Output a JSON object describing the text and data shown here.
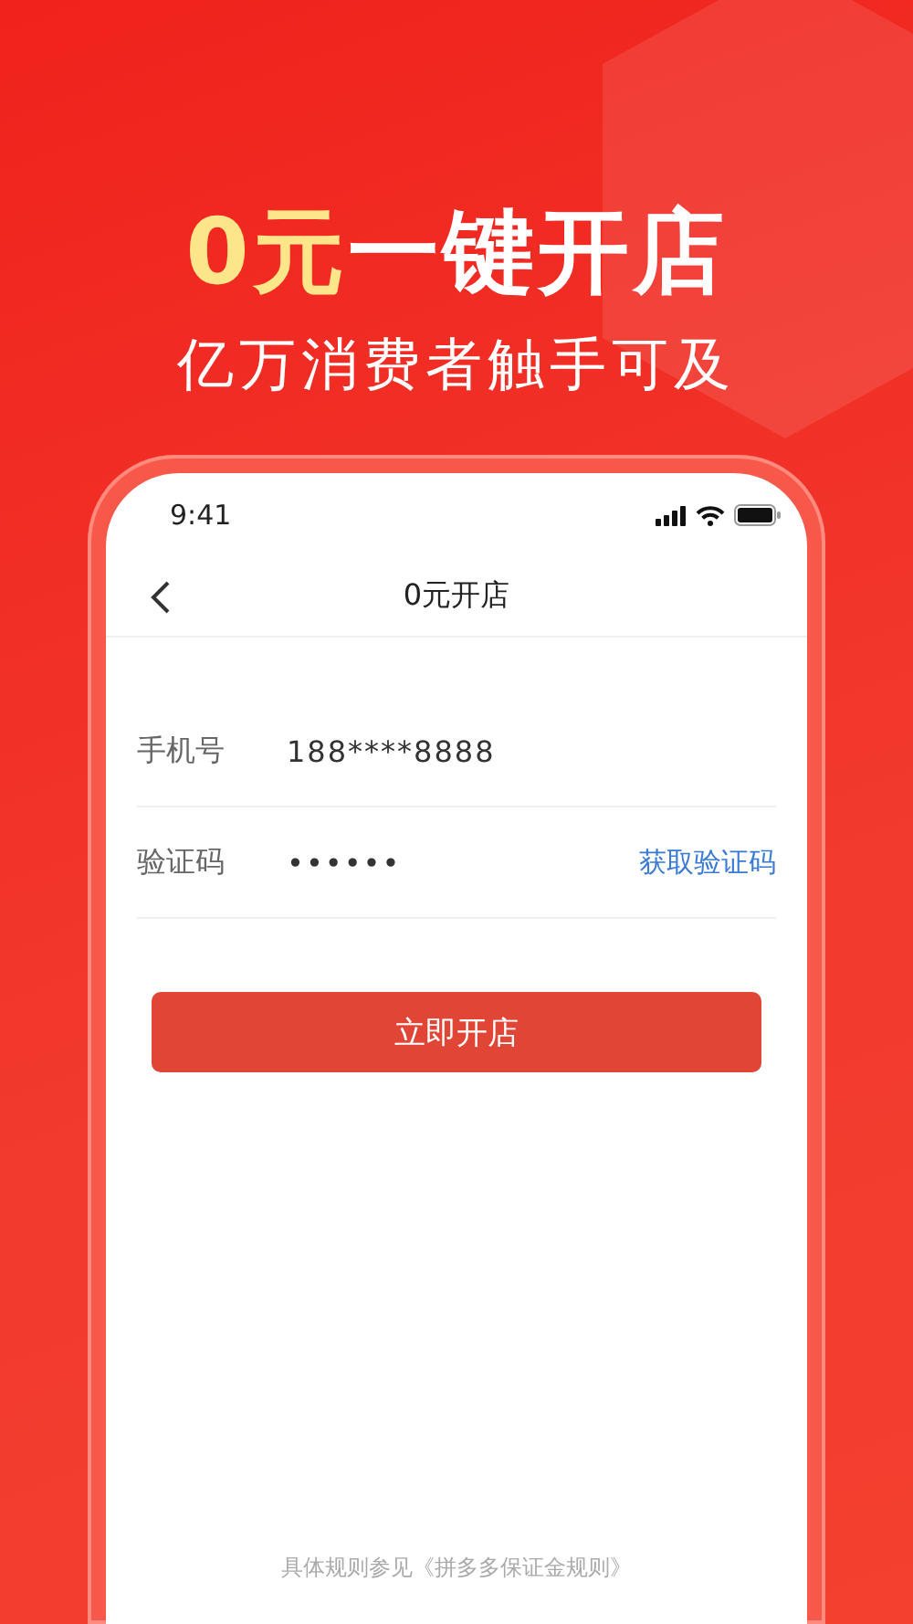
{
  "headline": {
    "accent": "0元",
    "text": "一键开店"
  },
  "subtitle": "亿万消费者触手可及",
  "phone": {
    "status_bar": {
      "time": "9:41"
    },
    "nav": {
      "title": "0元开店"
    },
    "fields": [
      {
        "label": "手机号",
        "value": "188****8888"
      },
      {
        "label": "验证码",
        "value": "••••••",
        "action": "获取验证码"
      }
    ],
    "submit": "立即开店",
    "footer": "具体规则参见《拼多多保证金规则》"
  }
}
